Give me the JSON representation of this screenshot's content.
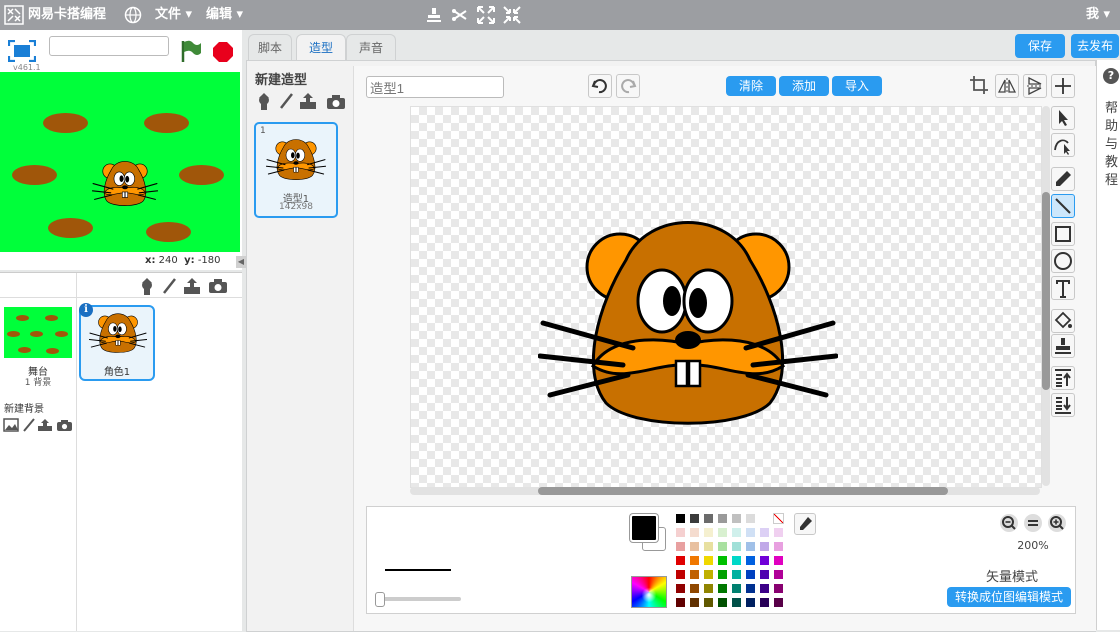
{
  "topbar": {
    "brand": "网易卡搭编程",
    "file_menu": "文件",
    "edit_menu": "编辑",
    "user": "我"
  },
  "stage": {
    "version": "v461.1",
    "name_input": "",
    "x_label": "x:",
    "x_value": "240",
    "y_label": "y:",
    "y_value": "-180"
  },
  "sprites": {
    "icons": [
      "sprite-library-icon",
      "paint-new-sprite-icon",
      "upload-sprite-icon",
      "camera-icon"
    ],
    "stage_label": "舞台",
    "stage_bg_count": "1 背景",
    "new_backdrop_label": "新建背景",
    "sprite1_label": "角色1"
  },
  "tabs": {
    "scripts": "脚本",
    "costumes": "造型",
    "sounds": "声音"
  },
  "header_buttons": {
    "save": "保存",
    "publish": "去发布"
  },
  "costumes": {
    "new_costume_label": "新建造型",
    "item": {
      "index": "1",
      "name": "造型1",
      "size": "142x98"
    }
  },
  "editor": {
    "costume_name": "造型1",
    "clear": "清除",
    "add": "添加",
    "import": "导入",
    "zoom": "200%",
    "mode_label": "矢量模式",
    "convert_button": "转换成位图编辑模式",
    "tools": [
      "select-icon",
      "reshape-icon",
      "pencil-icon",
      "line-icon",
      "rectangle-icon",
      "ellipse-icon",
      "text-icon",
      "fill-icon",
      "stamp-icon",
      "forward-layer-icon",
      "backward-layer-icon"
    ]
  },
  "help": {
    "icon": "?",
    "text": "帮助与教程"
  },
  "palette": {
    "primary": "#000000",
    "secondary": "#ffffff",
    "rows": [
      [
        "#000000",
        "#3b3b3b",
        "#6b6b6b",
        "#9a9a9a",
        "#c0c0c0",
        "#dcdcdc",
        "#ffffff",
        "none"
      ],
      [
        "#f5d0d0",
        "#f5dccf",
        "#f5f0d0",
        "#d8f0d0",
        "#d0f0ec",
        "#d0e0f5",
        "#dcd0f5",
        "#f0d0f0"
      ],
      [
        "#e8a0a0",
        "#e8c0a0",
        "#e8e0a0",
        "#a8e0a0",
        "#a0e0d8",
        "#a0c0e8",
        "#c0a8e8",
        "#e8a0e0"
      ],
      [
        "#e00000",
        "#f07800",
        "#f0d800",
        "#00c000",
        "#00d8c8",
        "#0060e0",
        "#7000d8",
        "#e000c0"
      ],
      [
        "#c00000",
        "#c06000",
        "#c0b000",
        "#00a000",
        "#00b0a0",
        "#0040c0",
        "#5000b0",
        "#b00098"
      ],
      [
        "#900000",
        "#904800",
        "#908400",
        "#007800",
        "#008070",
        "#003090",
        "#3c0088",
        "#880070"
      ],
      [
        "#600000",
        "#603000",
        "#605800",
        "#005000",
        "#005048",
        "#002060",
        "#280058",
        "#580048"
      ]
    ]
  }
}
